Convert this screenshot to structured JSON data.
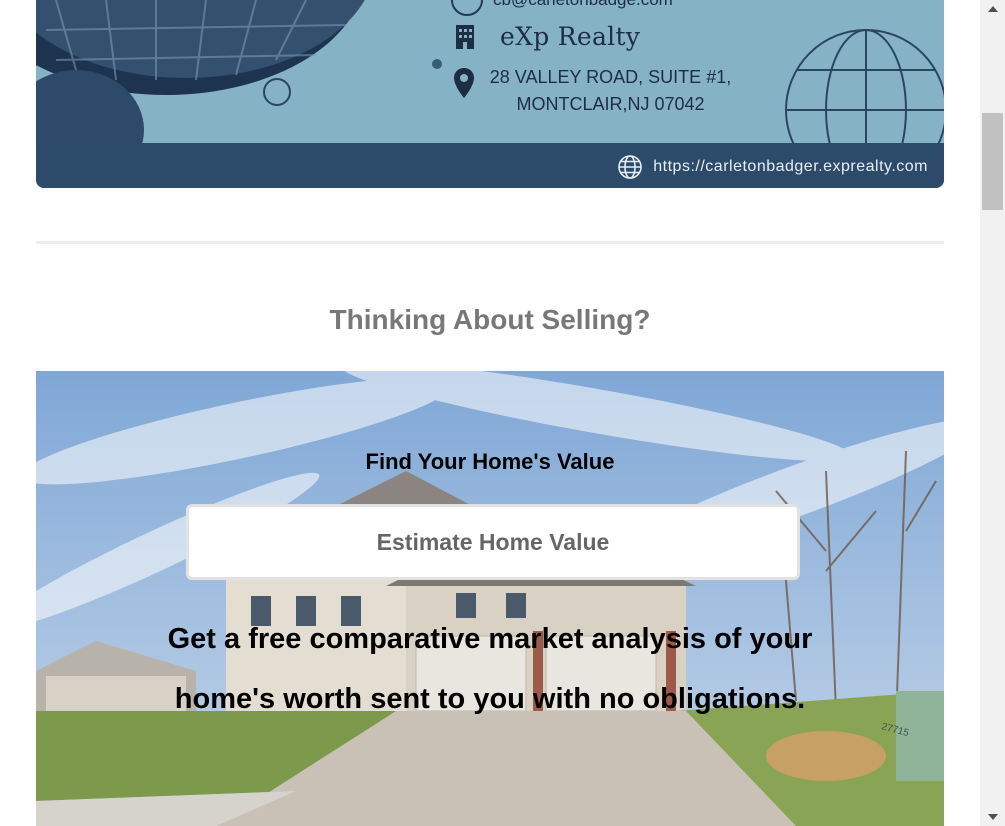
{
  "card": {
    "email": "cb@carletonbadge.com",
    "company": "eXp Realty",
    "address_line1": "28 VALLEY ROAD, SUITE #1,",
    "address_line2": "MONTCLAIR,NJ 07042",
    "website": "https://carletonbadger.exprealty.com"
  },
  "section": {
    "title": "Thinking About Selling?"
  },
  "hero": {
    "label": "Find Your Home's Value",
    "button_label": "Estimate Home Value",
    "tagline_line1": "Get a free comparative market analysis of your",
    "tagline_line2": "home's worth sent to you with no obligations.",
    "house_number": "27715"
  },
  "colors": {
    "card_bg": "#86b2c5",
    "card_footer": "#2c4a6a",
    "title_gray": "#787878"
  }
}
